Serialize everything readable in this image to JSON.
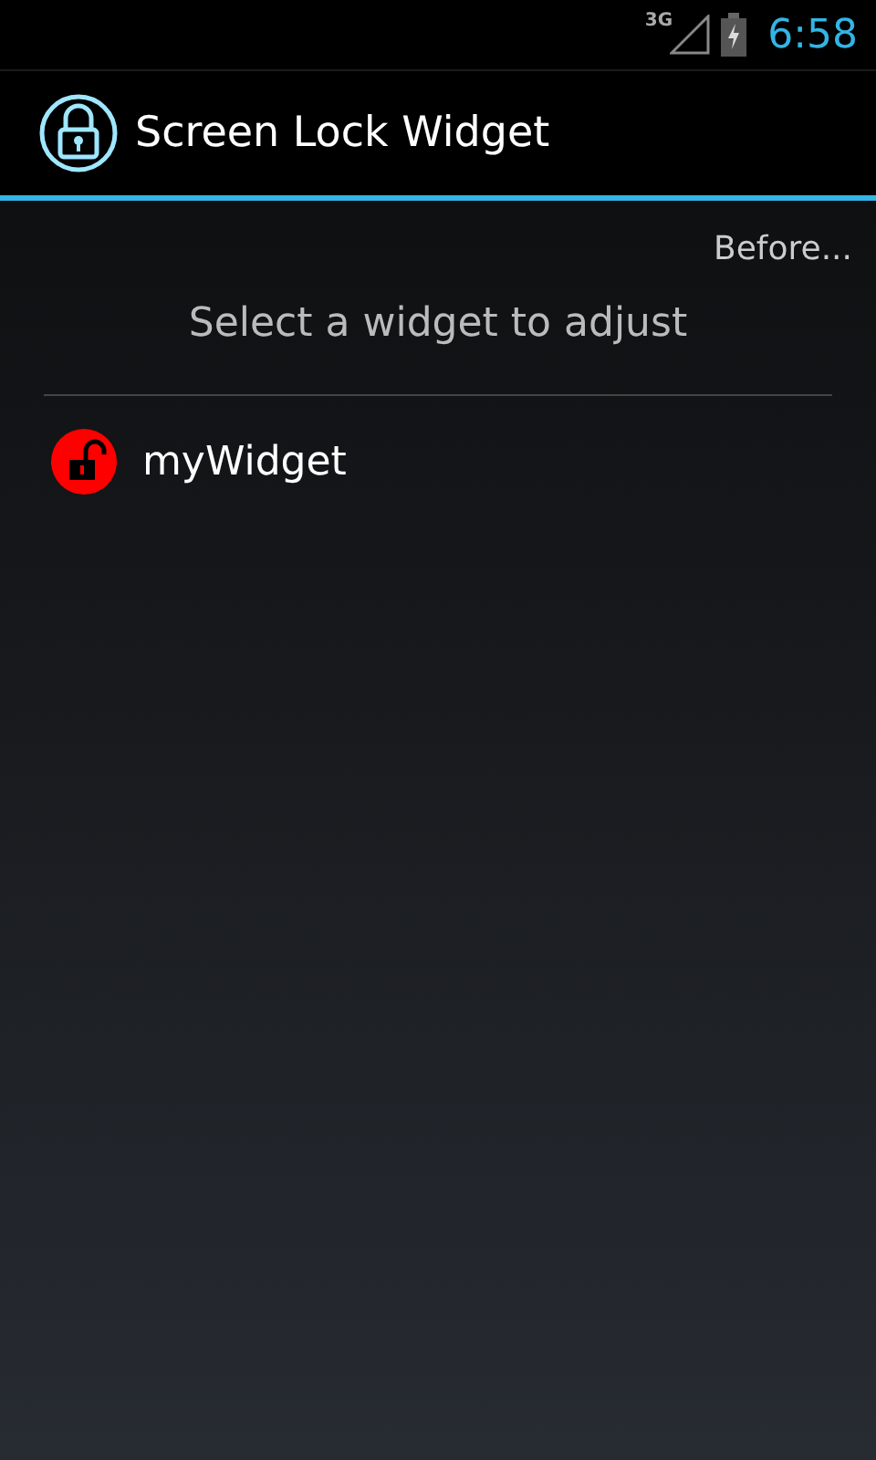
{
  "status_bar": {
    "network": "3G",
    "time": "6:58"
  },
  "action_bar": {
    "title": "Screen Lock Widget"
  },
  "before_link": "Before...",
  "prompt": "Select a widget to adjust",
  "widgets": [
    {
      "name": "myWidget",
      "locked": false
    }
  ]
}
